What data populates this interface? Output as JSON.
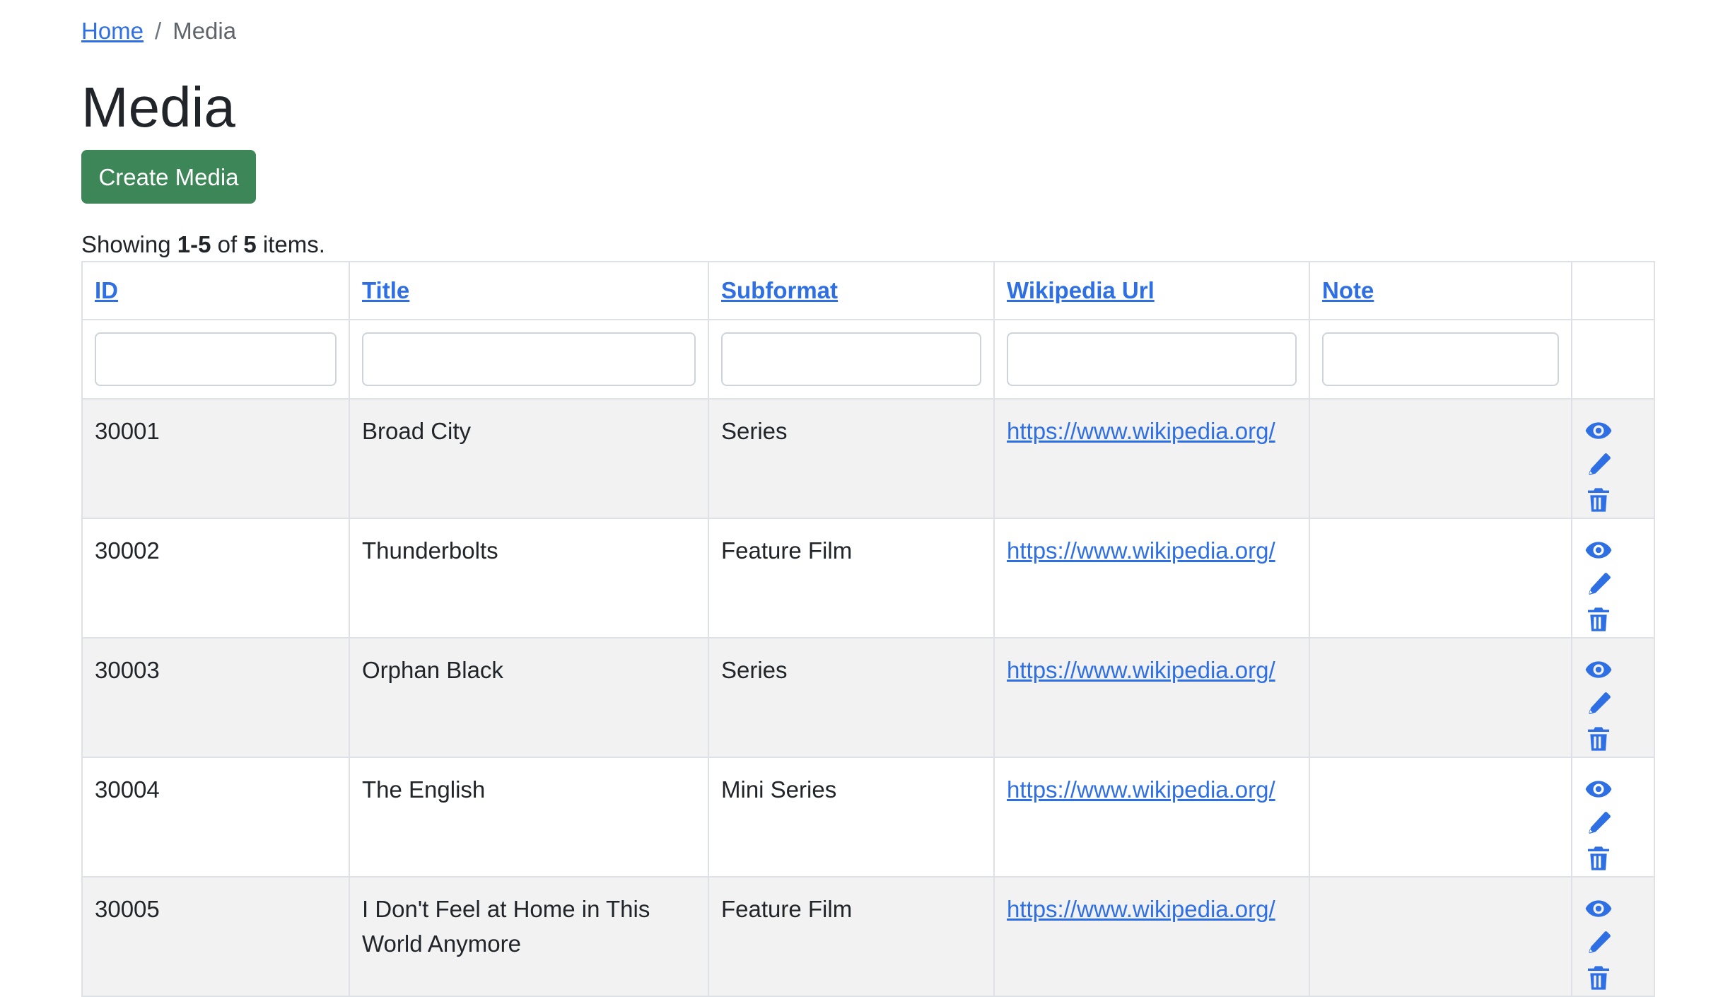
{
  "breadcrumb": {
    "home_label": "Home",
    "separator": "/",
    "current_label": "Media"
  },
  "page": {
    "title": "Media",
    "create_button_label": "Create Media"
  },
  "summary": {
    "prefix": "Showing ",
    "range": "1-5",
    "middle": " of ",
    "total": "5",
    "suffix": " items."
  },
  "table": {
    "headers": [
      "ID",
      "Title",
      "Subformat",
      "Wikipedia Url",
      "Note"
    ],
    "rows": [
      {
        "id": "30001",
        "title": "Broad City",
        "subformat": "Series",
        "wikipedia_url": "https://www.wikipedia.org/",
        "note": ""
      },
      {
        "id": "30002",
        "title": "Thunderbolts",
        "subformat": "Feature Film",
        "wikipedia_url": "https://www.wikipedia.org/",
        "note": ""
      },
      {
        "id": "30003",
        "title": "Orphan Black",
        "subformat": "Series",
        "wikipedia_url": "https://www.wikipedia.org/",
        "note": ""
      },
      {
        "id": "30004",
        "title": "The English",
        "subformat": "Mini Series",
        "wikipedia_url": "https://www.wikipedia.org/",
        "note": ""
      },
      {
        "id": "30005",
        "title": "I Don't Feel at Home in This World Anymore",
        "subformat": "Feature Film",
        "wikipedia_url": "https://www.wikipedia.org/",
        "note": ""
      }
    ],
    "row_actions": [
      "eye-icon",
      "pencil-icon",
      "trash-icon"
    ]
  },
  "colors": {
    "link": "#2f6fe4",
    "primary_button": "#3d8658",
    "striped_row": "#f2f2f2",
    "border": "#dee2e6"
  }
}
